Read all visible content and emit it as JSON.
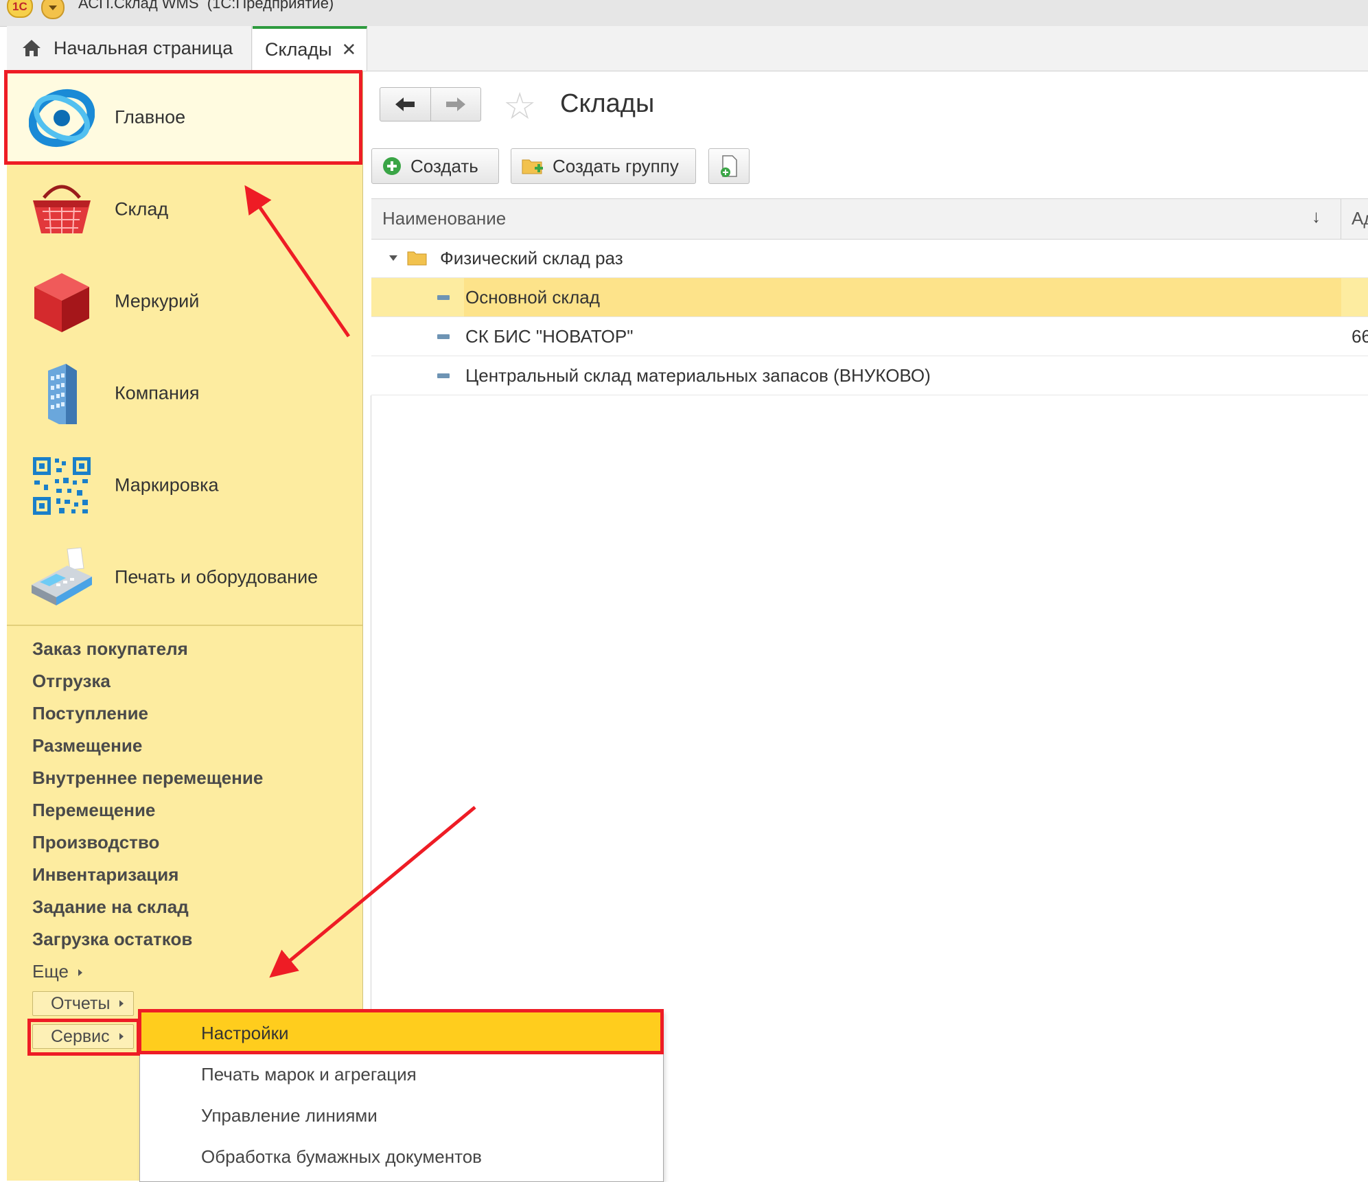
{
  "window": {
    "title": "АСП.Склад WMS  (1С:Предприятие)",
    "logo_text": "1C"
  },
  "tabs": [
    {
      "label": "Начальная страница"
    },
    {
      "label": "Склады",
      "close": "✕"
    }
  ],
  "sections": [
    {
      "label": "Главное",
      "icon": "main-section-icon"
    },
    {
      "label": "Склад",
      "icon": "basket-icon"
    },
    {
      "label": "Меркурий",
      "icon": "mercury-cube-icon"
    },
    {
      "label": "Компания",
      "icon": "building-icon"
    },
    {
      "label": "Маркировка",
      "icon": "qr-code-icon"
    },
    {
      "label": "Печать и оборудование",
      "icon": "cash-register-icon"
    }
  ],
  "commands": [
    "Заказ покупателя",
    "Отгрузка",
    "Поступление",
    "Размещение",
    "Внутреннее перемещение",
    "Перемещение",
    "Производство",
    "Инвентаризация",
    "Задание на склад",
    "Загрузка остатков"
  ],
  "more_label": "Еще",
  "reports_label": "Отчеты",
  "service_label": "Сервис",
  "page": {
    "title": "Склады"
  },
  "toolbar": {
    "create": "Создать",
    "create_group": "Создать группу"
  },
  "table": {
    "col_name": "Наименование",
    "sort_indicator": "↓",
    "col_second": "Ад",
    "rows": [
      {
        "name": "Физический склад раз",
        "type": "group",
        "extra": ""
      },
      {
        "name": "Основной склад",
        "type": "item",
        "extra": ""
      },
      {
        "name": "СК БИС \"НОВАТОР\"",
        "type": "item",
        "extra": "66"
      },
      {
        "name": "Центральный склад материальных запасов (ВНУКОВО)",
        "type": "item",
        "extra": ""
      }
    ]
  },
  "service_menu": [
    "Настройки",
    "Печать марок и агрегация",
    "Управление линиями",
    "Обработка бумажных документов"
  ],
  "colors": {
    "panel": "#fdeca0",
    "highlight": "#ffcd1d",
    "selected_row": "#fde38a",
    "annotation": "#ee1c25",
    "active_tab": "#2e9b3e"
  }
}
